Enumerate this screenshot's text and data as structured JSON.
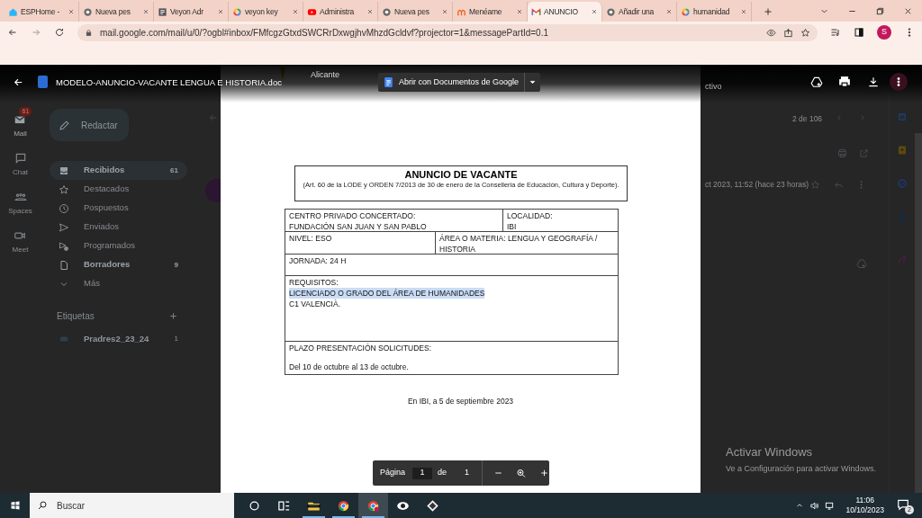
{
  "browser": {
    "tabs": [
      {
        "kind": "home",
        "title": "ESPHome -",
        "selected": false
      },
      {
        "kind": "globe",
        "title": "Nueva pes",
        "selected": false
      },
      {
        "kind": "doc",
        "title": "Veyon Adr",
        "selected": false
      },
      {
        "kind": "google",
        "title": "veyon key",
        "selected": false
      },
      {
        "kind": "youtube",
        "title": "Administra",
        "selected": false
      },
      {
        "kind": "globe",
        "title": "Nueva pes",
        "selected": false
      },
      {
        "kind": "meneame",
        "title": "Menéame",
        "selected": false
      },
      {
        "kind": "gmail",
        "title": "ANUNCIO",
        "selected": true
      },
      {
        "kind": "globe",
        "title": "Añadir una",
        "selected": false
      },
      {
        "kind": "google",
        "title": "humanidad",
        "selected": false
      }
    ],
    "url": "mail.google.com/mail/u/0/?ogbl#inbox/FMfcgzGtxdSWCRrDxwgjhvMhzdGcldvf?projector=1&messagePartId=0.1",
    "profile_initial": "S"
  },
  "gmail": {
    "rail": [
      {
        "kind": "mail",
        "label": "Mail",
        "badge": "61",
        "selected": true
      },
      {
        "kind": "chat",
        "label": "Chat",
        "selected": false
      },
      {
        "kind": "spaces",
        "label": "Spaces",
        "selected": false
      },
      {
        "kind": "meet",
        "label": "Meet",
        "selected": false
      }
    ],
    "compose": "Redactar",
    "folders": [
      {
        "kind": "inbox",
        "label": "Recibidos",
        "count": "61",
        "selected": true,
        "unread": true
      },
      {
        "kind": "star",
        "label": "Destacados",
        "selected": false,
        "unread": false
      },
      {
        "kind": "clock",
        "label": "Pospuestos",
        "selected": false,
        "unread": false
      },
      {
        "kind": "send",
        "label": "Enviados",
        "selected": false,
        "unread": false
      },
      {
        "kind": "scheduled",
        "label": "Programados",
        "selected": false,
        "unread": false
      },
      {
        "kind": "draft",
        "label": "Borradores",
        "count": "9",
        "selected": false,
        "unread": true
      },
      {
        "kind": "more",
        "label": "Más",
        "selected": false,
        "unread": false
      }
    ],
    "labels_heading": "Etiquetas",
    "labels": [
      {
        "name": "Pradres2_23_24",
        "count": "1"
      }
    ],
    "status_fragment": "ctivo",
    "pager": "2 de 106",
    "email_date": "ct 2023, 11:52 (hace 23 horas)"
  },
  "viewer": {
    "filename": "MODELO-ANUNCIO-VACANTE LENGUA E HISTORIA.doc",
    "open_with": "Abrir con Documentos de Google",
    "page_label": "Página",
    "page": "1",
    "of_label": "de",
    "total": "1"
  },
  "document": {
    "header_fragment": "Alicante",
    "title": "ANUNCIO DE VACANTE",
    "subtitle": "(Art. 60 de la LODE y ORDEN 7/2013 de 30 de enero de la Conselleria de Educación, Cultura y Deporte).",
    "rows": [
      {
        "kind": "split_wide",
        "cells": [
          {
            "lines": [
              {
                "text": "CENTRO PRIVADO CONCERTADO:",
                "highlighted": false
              },
              {
                "text": "FUNDACIÓN SAN JUAN Y SAN PABLO",
                "highlighted": false
              }
            ]
          },
          {
            "lines": [
              {
                "text": "LOCALIDAD:",
                "highlighted": false
              },
              {
                "text": "IBI",
                "highlighted": false
              }
            ]
          }
        ]
      },
      {
        "kind": "split_half",
        "cells": [
          {
            "lines": [
              {
                "text": "NIVEL:  ESO",
                "highlighted": false
              }
            ]
          },
          {
            "lines": [
              {
                "text": "ÁREA O MATERIA:  LENGUA Y GEOGRAFÍA /",
                "highlighted": false
              },
              {
                "text": "HISTORIA",
                "highlighted": false
              }
            ]
          }
        ]
      },
      {
        "kind": "full",
        "cells": [
          {
            "lines": [
              {
                "text": "JORNADA:  24 H",
                "highlighted": false
              }
            ]
          }
        ]
      },
      {
        "kind": "full_tall",
        "cells": [
          {
            "lines": [
              {
                "text": "REQUISITOS:",
                "highlighted": false
              },
              {
                "text": "LICENCIADO O GRADO DEL ÁREA DE HUMANIDADES",
                "highlighted": true
              },
              {
                "text": "C1 VALENCIÀ.",
                "highlighted": false
              }
            ]
          }
        ]
      },
      {
        "kind": "full_spaced",
        "cells": [
          {
            "lines": [
              {
                "text": "PLAZO PRESENTACIÓN SOLICITUDES:",
                "highlighted": false
              },
              {
                "text": "Del 10 de octubre al 13 de octubre.",
                "highlighted": false
              }
            ]
          }
        ]
      }
    ],
    "closing": "En IBI, a 5 de septiembre 2023"
  },
  "activation_notice": {
    "title": "Activar Windows",
    "text": "Ve a Configuración para activar Windows."
  },
  "taskbar": {
    "search_placeholder": "Buscar",
    "apps": [
      {
        "kind": "cortana",
        "running": false,
        "selected": false
      },
      {
        "kind": "taskview",
        "running": false,
        "selected": false
      },
      {
        "kind": "explorer",
        "running": true,
        "selected": false
      },
      {
        "kind": "chrome",
        "running": true,
        "selected": false
      },
      {
        "kind": "chrome_profile",
        "running": true,
        "selected": true
      },
      {
        "kind": "eye",
        "running": false,
        "selected": false
      },
      {
        "kind": "diamond",
        "running": false,
        "selected": false
      }
    ],
    "time": "11:06",
    "date": "10/10/2023",
    "notifications": "2"
  }
}
